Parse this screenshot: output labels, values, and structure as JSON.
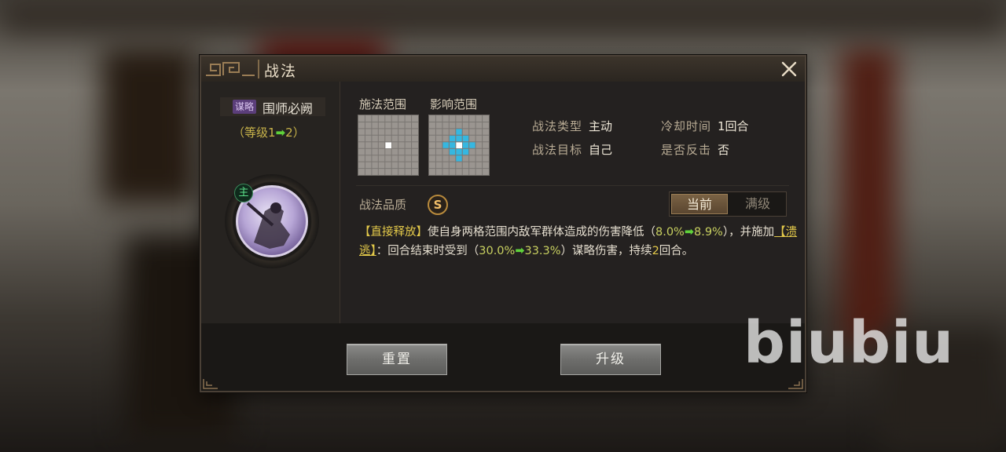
{
  "dialog": {
    "title": "战法",
    "close_icon": "close-icon"
  },
  "skill": {
    "tag": "谋略",
    "name": "围师必阙",
    "level_open": "（等级",
    "level_from": "1",
    "level_arrow": "➡",
    "level_to": "2",
    "level_close": "）",
    "portrait_badge": "主"
  },
  "range": {
    "cast_label": "施法范围",
    "effect_label": "影响范围"
  },
  "info": {
    "type_key": "战法类型",
    "type_value": "主动",
    "cooldown_key": "冷却时间",
    "cooldown_value": "1回合",
    "target_key": "战法目标",
    "target_value": "自己",
    "counter_key": "是否反击",
    "counter_value": "否"
  },
  "quality": {
    "label": "战法品质",
    "grade": "S"
  },
  "toggle": {
    "current": "当前",
    "max": "满级"
  },
  "description": {
    "kw1": "【直接释放】",
    "t1": "使自身两格范围内敌军群体造成的伤害降低（",
    "n1a": "8.0%",
    "n1b": "8.9%",
    "t2": "），并施加",
    "kw2": "【溃逃】",
    "t3": "：回合结束时受到（",
    "n2a": "30.0%",
    "n2b": "33.3%",
    "t4": "）谋略伤害，持续",
    "n3": "2",
    "t5": "回合。",
    "arrow": "➡"
  },
  "buttons": {
    "reset": "重置",
    "upgrade": "升级"
  },
  "watermark": "biubiu",
  "colors": {
    "accent_gold": "#e3c94a",
    "arrow_green": "#5fd13a",
    "tag_purple": "#5b3e7a",
    "effect_cyan": "#36b7e0"
  }
}
